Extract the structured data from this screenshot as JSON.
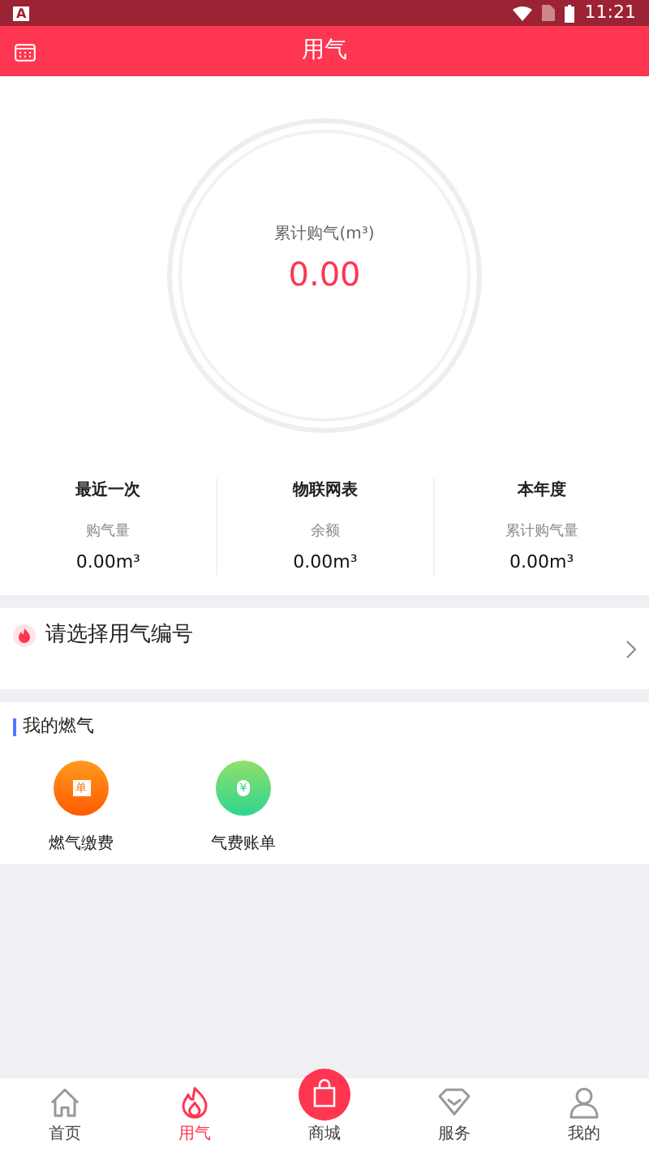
{
  "status_bar": {
    "time": "11:21",
    "app_badge": "A"
  },
  "header": {
    "title": "用气"
  },
  "gauge": {
    "label": "累计购气(m³)",
    "value": "0.00"
  },
  "stats": [
    {
      "title": "最近一次",
      "label": "购气量",
      "value": "0.00m³"
    },
    {
      "title": "物联网表",
      "label": "余额",
      "value": "0.00m³"
    },
    {
      "title": "本年度",
      "label": "累计购气量",
      "value": "0.00m³"
    }
  ],
  "account_select": {
    "label": "请选择用气编号"
  },
  "my_gas": {
    "title": "我的燃气",
    "items": [
      {
        "label": "燃气缴费",
        "glyph": "单",
        "kind": "payment"
      },
      {
        "label": "气费账单",
        "glyph": "¥",
        "kind": "bill"
      }
    ]
  },
  "bottom_nav": [
    {
      "label": "首页",
      "kind": "home",
      "selected": false
    },
    {
      "label": "用气",
      "kind": "flame",
      "selected": true
    },
    {
      "label": "商城",
      "kind": "shop",
      "selected": false
    },
    {
      "label": "服务",
      "kind": "service",
      "selected": false
    },
    {
      "label": "我的",
      "kind": "profile",
      "selected": false
    }
  ]
}
